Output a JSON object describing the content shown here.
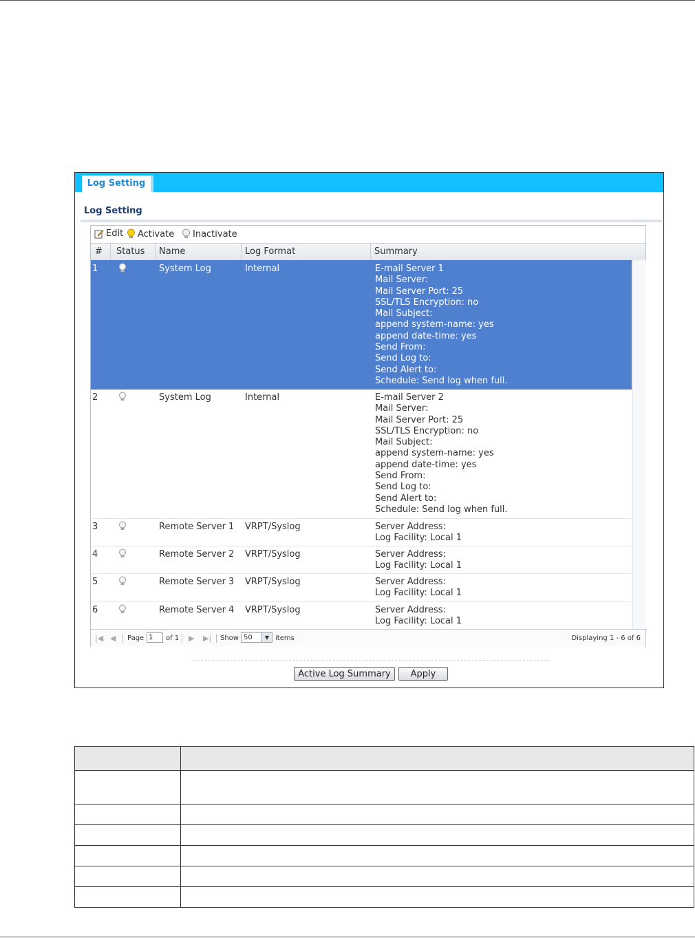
{
  "tab_label": "Log Setting",
  "section_title": "Log Setting",
  "toolbar": {
    "edit": "Edit",
    "activate": "Activate",
    "inactivate": "Inactivate"
  },
  "columns": {
    "num": "#",
    "status": "Status",
    "name": "Name",
    "format": "Log Format",
    "summary": "Summary"
  },
  "rows": [
    {
      "num": "1",
      "name": "System Log",
      "format": "Internal",
      "summary": "E-mail Server 1\nMail Server:\nMail Server Port: 25\nSSL/TLS Encryption: no\nMail Subject:\nappend system-name: yes\nappend date-time: yes\nSend From:\nSend Log to:\nSend Alert to:\nSchedule: Send log when full."
    },
    {
      "num": "2",
      "name": "System Log",
      "format": "Internal",
      "summary": "E-mail Server 2\nMail Server:\nMail Server Port: 25\nSSL/TLS Encryption: no\nMail Subject:\nappend system-name: yes\nappend date-time: yes\nSend From:\nSend Log to:\nSend Alert to:\nSchedule: Send log when full."
    },
    {
      "num": "3",
      "name": "Remote Server 1",
      "format": "VRPT/Syslog",
      "summary": "Server Address:\nLog Facility: Local 1"
    },
    {
      "num": "4",
      "name": "Remote Server 2",
      "format": "VRPT/Syslog",
      "summary": "Server Address:\nLog Facility: Local 1"
    },
    {
      "num": "5",
      "name": "Remote Server 3",
      "format": "VRPT/Syslog",
      "summary": "Server Address:\nLog Facility: Local 1"
    },
    {
      "num": "6",
      "name": "Remote Server 4",
      "format": "VRPT/Syslog",
      "summary": "Server Address:\nLog Facility: Local 1"
    }
  ],
  "pager": {
    "page_label": "Page",
    "page_value": "1",
    "of_label": "of 1",
    "show_label": "Show",
    "show_value": "50",
    "items_label": "items",
    "displaying": "Displaying 1 - 6 of 6"
  },
  "buttons": {
    "summary": "Active Log Summary",
    "apply": "Apply"
  },
  "selection_color": "#4f7fcf",
  "tab_color": "#12c0ff"
}
